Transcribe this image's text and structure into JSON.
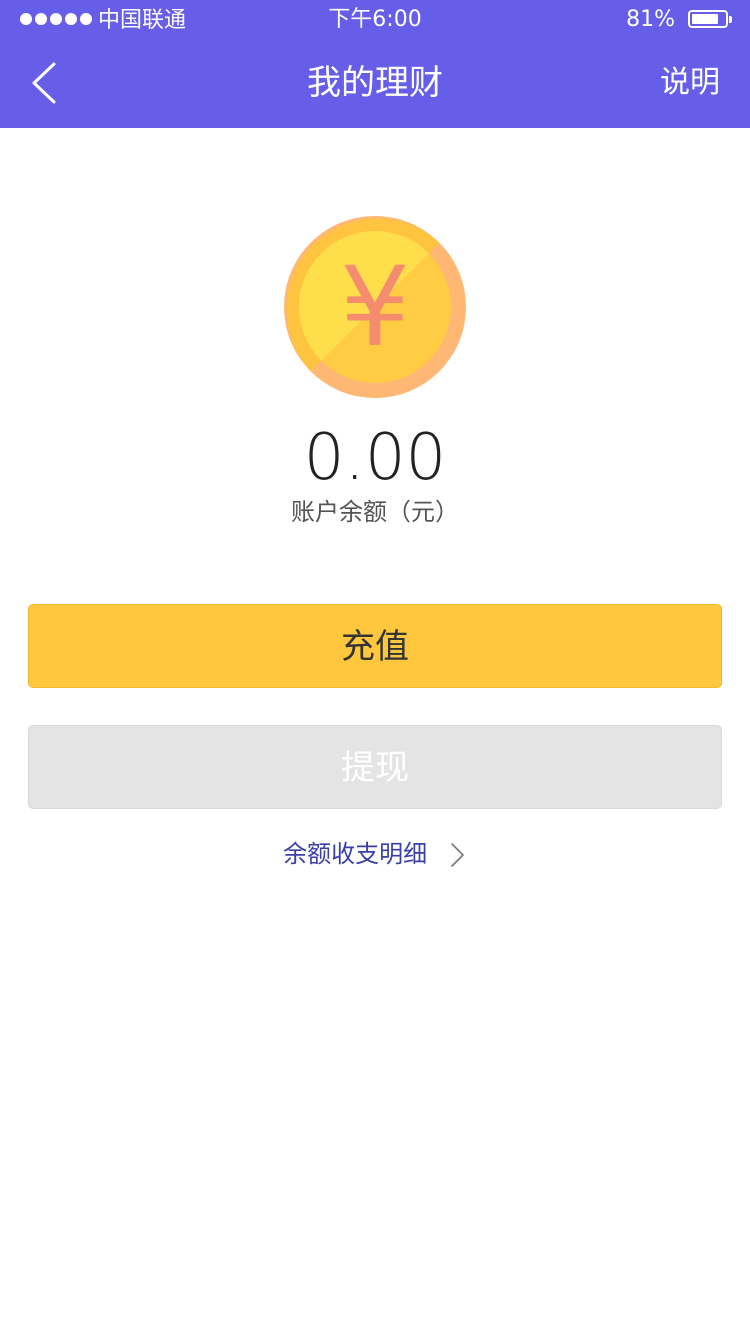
{
  "status_bar": {
    "carrier": "中国联通",
    "time": "下午6:00",
    "battery_percent": "81%",
    "battery_level": 0.81
  },
  "nav": {
    "title": "我的理财",
    "right_action": "说明",
    "back_icon": "chevron-left-icon"
  },
  "balance": {
    "coin_icon": "yen-coin-icon",
    "coin_symbol": "¥",
    "amount": "0.00",
    "label": "账户余额（元）"
  },
  "actions": {
    "recharge_label": "充值",
    "withdraw_label": "提现"
  },
  "detail_link": {
    "label": "余额收支明细",
    "icon": "chevron-right-icon"
  },
  "colors": {
    "header": "#665EE8",
    "recharge_button": "#FEC73E",
    "withdraw_button": "#E4E4E4",
    "link": "#3A3FA8",
    "coin_outer": "#FFB873",
    "coin_inner": "#FFDE4C",
    "yen_symbol": "#F58C6E"
  }
}
